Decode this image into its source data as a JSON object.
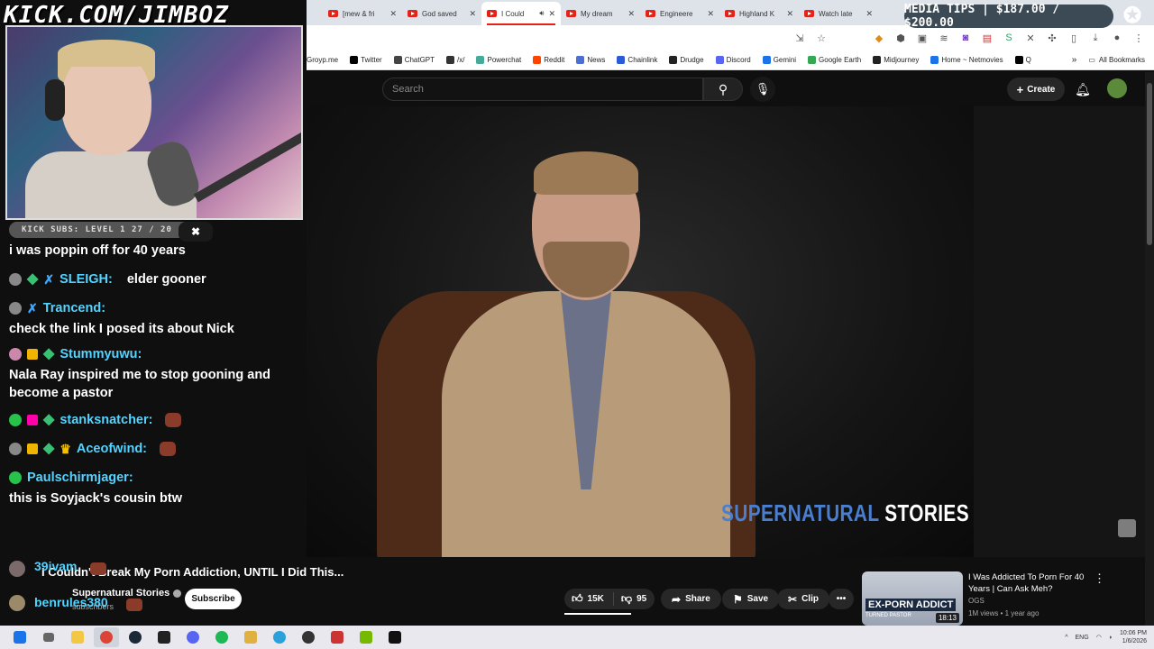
{
  "overlay": {
    "kick_url": "KICK.COM/JIMBOZ",
    "media_tips": "MEDIA TIPS | $187.00 / $200.00",
    "kick_subs": "KICK SUBS: LEVEL 1 27 / 20",
    "subs_progress": 1.0
  },
  "browser": {
    "tabs": [
      {
        "label": "[mew & fri",
        "active": false
      },
      {
        "label": "God saved",
        "active": false
      },
      {
        "label": "I Could",
        "active": true
      },
      {
        "label": "My dream",
        "active": false
      },
      {
        "label": "Engineere",
        "active": false
      },
      {
        "label": "Highland K",
        "active": false
      },
      {
        "label": "Watch late",
        "active": false
      }
    ],
    "bookmarks": [
      "Groyp.me",
      "Twitter",
      "ChatGPT",
      "/x/",
      "Powerchat",
      "Reddit",
      "News",
      "Chainlink",
      "Drudge",
      "Discord",
      "Gemini",
      "Google Earth",
      "Midjourney",
      "Home ~ Netmovies",
      "Q"
    ],
    "all_bookmarks": "All Bookmarks"
  },
  "chat": [
    {
      "user": "",
      "text": "i was poppin off for 40 years",
      "inline": false
    },
    {
      "user": "SLEIGH:",
      "text": "elder gooner",
      "inline": true,
      "color": "blue"
    },
    {
      "user": "Trancend:",
      "text": "check the link I posed its about Nick",
      "inline": false,
      "color": "blue"
    },
    {
      "user": "Stummyuwu:",
      "text": "Nala Ray inspired me to stop gooning and become a pastor",
      "inline": false,
      "color": "blue"
    },
    {
      "user": "stanksnatcher:",
      "text": "",
      "inline": true,
      "color": "blue"
    },
    {
      "user": "Aceofwind:",
      "text": "",
      "inline": true,
      "color": "blue"
    },
    {
      "user": "Paulschirmjager:",
      "text": "this is Soyjack's cousin btw",
      "inline": false,
      "color": "blue"
    }
  ],
  "overlay_names": [
    "39ivam",
    "benrules380"
  ],
  "youtube": {
    "search_placeholder": "Search",
    "create_label": "Create",
    "video_brand_1": "SUPERNATURAL",
    "video_brand_2": "STORIES",
    "title": "I Couldn't Break My Porn Addiction, UNTIL I Did This...",
    "channel": "Supernatural Stories",
    "subscribers": "subscribers",
    "subscribe_label": "Subscribe",
    "likes": "15K",
    "dislikes": "95",
    "share": "Share",
    "save": "Save",
    "clip": "Clip",
    "more": "•••"
  },
  "recommended": {
    "title": "I Was Addicted To Porn For 40 Years | Can Ask Meh?",
    "channel": "OGS",
    "meta": "1M views • 1 year ago",
    "duration": "18:13",
    "thumb_text": "EX-PORN ADDICT",
    "thumb_sub": "TURNED PASTOR"
  },
  "taskbar": {
    "lang": "ENG",
    "time": "10:06 PM",
    "date": "1/6/2026"
  }
}
